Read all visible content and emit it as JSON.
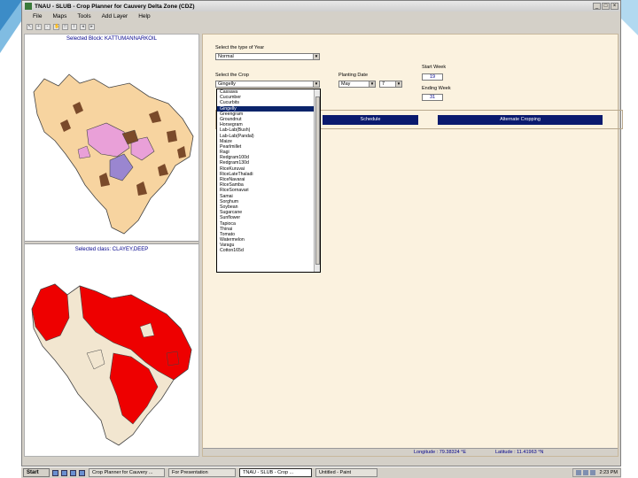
{
  "window": {
    "title": "TNAU - SLUB - Crop Planner for Cauvery Delta Zone (CDZ)",
    "controls": [
      "_",
      "□",
      "×"
    ]
  },
  "menu": [
    "File",
    "Maps",
    "Tools",
    "Add Layer",
    "Help"
  ],
  "toolbar_icons": [
    "select-tool-icon",
    "zoom-in-icon",
    "zoom-out-icon",
    "pan-icon",
    "full-extent-icon",
    "identify-icon",
    "back-icon",
    "forward-icon"
  ],
  "map_panel": {
    "block_label": "Selected Block: KATTUMANNARKOIL",
    "class_label": "Selected class: CLAYEY,DEEP"
  },
  "form": {
    "year_type_label": "Select the type of Year",
    "year_type_value": "Normal",
    "crop_label": "Select the Crop",
    "crop_value": "Gingelly",
    "planting_label": "Planting Date",
    "planting_month": "May",
    "planting_day": "7",
    "start_week_label": "Start Week",
    "start_week_value": "19",
    "ending_week_label": "Ending Week",
    "ending_week_value": "31",
    "schedule_button": "Schedule",
    "alternate_button": "Alternate Cropping"
  },
  "crop_list": [
    "Cassava",
    "Cucumber",
    "Cucurbits",
    "Gingelly",
    "Greengram",
    "Groundnut",
    "Horsegram",
    "Lab-Lab(Bush)",
    "Lab-Lab(Pandal)",
    "Maize",
    "Pearlmillet",
    "Ragi",
    "Redgram100d",
    "Redgram130d",
    "RiceKuruvai",
    "RiceLateThaladi",
    "RiceNavarai",
    "RiceSamba",
    "RiceSornavari",
    "Samai",
    "Sorghum",
    "Soybean",
    "Sugarcane",
    "Sunflower",
    "Tapioca",
    "Thinai",
    "Tomato",
    "Watermelon",
    "Varagu",
    "Cotton165d"
  ],
  "crop_selected_index": 3,
  "status": {
    "longitude": "Longitude : 79.38324 °E",
    "latitude": "Latitude : 11.41963 °N"
  },
  "taskbar": {
    "start": "Start",
    "tasks": [
      "Crop Planner for Cauvery ...",
      "For Presentation",
      "TNAU - SLUB - Crop ...",
      "Untitled - Paint"
    ],
    "active_task_index": 2,
    "clock": "2:23 PM"
  }
}
